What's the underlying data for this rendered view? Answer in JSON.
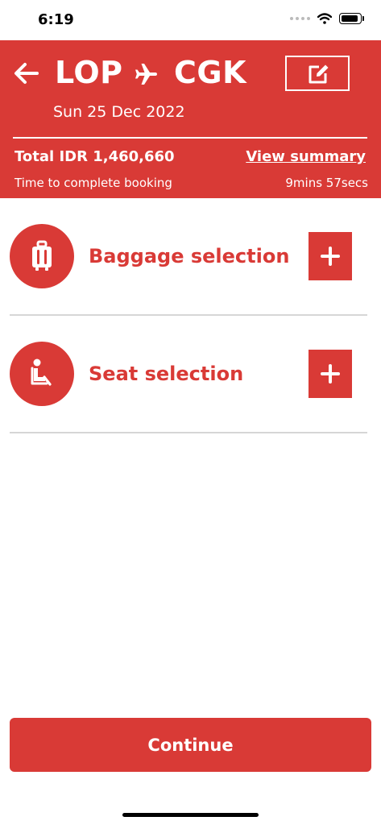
{
  "status_bar": {
    "time": "6:19"
  },
  "header": {
    "origin": "LOP",
    "destination": "CGK",
    "date": "Sun 25 Dec 2022",
    "total": "Total IDR 1,460,660",
    "view_summary": "View summary",
    "timer_label": "Time to complete booking",
    "timer_value": "9mins 57secs"
  },
  "sections": [
    {
      "label": "Baggage selection",
      "icon": "luggage-icon"
    },
    {
      "label": "Seat selection",
      "icon": "seat-icon"
    }
  ],
  "continue_label": "Continue",
  "colors": {
    "accent": "#d93a36",
    "divider": "#d6d6d6"
  }
}
